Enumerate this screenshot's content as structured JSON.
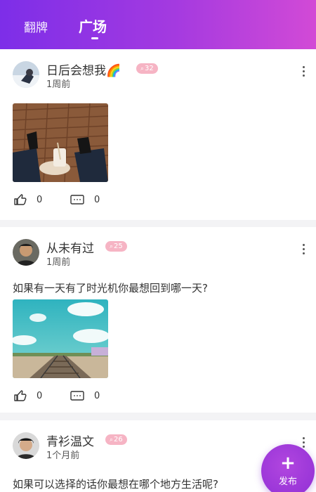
{
  "header": {
    "tabs": [
      {
        "label": "翻牌",
        "active": false
      },
      {
        "label": "广场",
        "active": true
      }
    ]
  },
  "posts": [
    {
      "username": "日后会想我🌈",
      "badge": "32",
      "time": "1周前",
      "text": "",
      "likes": "0",
      "comments": "0"
    },
    {
      "username": "从未有过",
      "badge": "25",
      "time": "1周前",
      "text": "如果有一天有了时光机你最想回到哪一天?",
      "likes": "0",
      "comments": "0"
    },
    {
      "username": "青衫温文",
      "badge": "26",
      "time": "1个月前",
      "text": "如果可以选择的话你最想在哪个地方生活呢?"
    }
  ],
  "fab": {
    "label": "发布",
    "icon": "+"
  },
  "colors": {
    "accent": "#9a36d8",
    "badge": "#f6b4c4",
    "header_start": "#7d2ee8",
    "header_end": "#d24ad6"
  }
}
